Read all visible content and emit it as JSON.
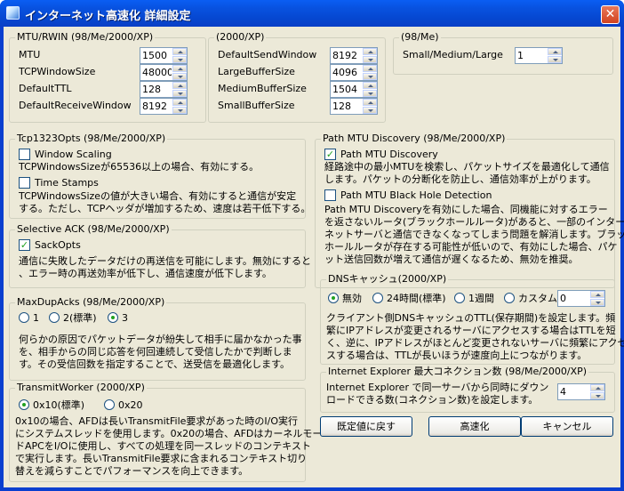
{
  "window": {
    "title": "インターネット高速化 詳細設定",
    "close_symbol": "✕"
  },
  "mtu_group": {
    "title": "MTU/RWIN (98/Me/2000/XP)",
    "fields": [
      {
        "label": "MTU",
        "value": "1500"
      },
      {
        "label": "TCPWindowSize",
        "value": "48000"
      },
      {
        "label": "DefaultTTL",
        "value": "128"
      },
      {
        "label": "DefaultReceiveWindow",
        "value": "8192"
      }
    ]
  },
  "buffer_group": {
    "title": "(2000/XP)",
    "fields": [
      {
        "label": "DefaultSendWindow",
        "value": "8192"
      },
      {
        "label": "LargeBufferSize",
        "value": "4096"
      },
      {
        "label": "MediumBufferSize",
        "value": "1504"
      },
      {
        "label": "SmallBufferSize",
        "value": "128"
      }
    ]
  },
  "size_group": {
    "title": "(98/Me)",
    "label": "Small/Medium/Large",
    "value": "1"
  },
  "tcp1323": {
    "title": "Tcp1323Opts (98/Me/2000/XP)",
    "window_scaling": {
      "label": "Window Scaling",
      "checked": false
    },
    "window_scaling_desc": "TCPWindowsSizeが65536以上の場合、有効にする。",
    "time_stamps": {
      "label": "Time Stamps",
      "checked": false
    },
    "time_stamps_desc_1": "TCPWindowsSizeの値が大きい場合、有効にすると通信が安定",
    "time_stamps_desc_2": "する。ただし、TCPヘッダが増加するため、速度は若干低下する。"
  },
  "sack": {
    "title": "Selective ACK (98/Me/2000/XP)",
    "option": {
      "label": "SackOpts",
      "checked": true
    },
    "desc_1": "通信に失敗したデータだけの再送信を可能にします。無効にすると",
    "desc_2": "、エラー時の再送効率が低下し、通信速度が低下します。"
  },
  "maxdupacks": {
    "title": "MaxDupAcks (98/Me/2000/XP)",
    "options": [
      "1",
      "2(標準)",
      "3"
    ],
    "selected": "3",
    "desc_1": "何らかの原因でパケットデータが紛失して相手に届かなかった事",
    "desc_2": "を、相手からの同じ応答を何回連続して受信したかで判断しま",
    "desc_3": "す。その受信回数を指定することで、送受信を最適化します。"
  },
  "transmit": {
    "title": "TransmitWorker (2000/XP)",
    "options": [
      "0x10(標準)",
      "0x20"
    ],
    "selected": "0x10(標準)",
    "desc_1": "0x10の場合、AFDは長いTransmitFile要求があった時のI/O実行",
    "desc_2": "にシステムスレッドを使用します。0x20の場合、AFDはカーネルモー",
    "desc_3": "ドAPCをI/Oに使用し、すべての処理を同一スレッドのコンテキスト",
    "desc_4": "で実行します。長いTransmitFile要求に含まれるコンテキスト切り",
    "desc_5": "替えを減らすことでパフォーマンスを向上できます。"
  },
  "pmtu": {
    "title": "Path MTU Discovery (98/Me/2000/XP)",
    "discovery": {
      "label": "Path MTU Discovery",
      "checked": true
    },
    "discovery_desc_1": "経路途中の最小MTUを検索し、パケットサイズを最適化して通信",
    "discovery_desc_2": "します。パケットの分断化を防止し、通信効率が上がります。",
    "blackhole": {
      "label": "Path MTU Black Hole Detection",
      "checked": false
    },
    "blackhole_desc_1": "Path MTU Discoveryを有効にした場合、同機能に対するエラー",
    "blackhole_desc_2": "を返さないルータ(ブラックホールルータ)があると、一部のインター",
    "blackhole_desc_3": "ネットサーバと通信できなくなってしまう問題を解消します。ブラック",
    "blackhole_desc_4": "ホールルータが存在する可能性が低いので、有効にした場合、パケ",
    "blackhole_desc_5": "ット送信回数が増えて通信が遅くなるため、無効を推奨。"
  },
  "dns": {
    "title": "DNSキャッシュ(2000/XP)",
    "options": [
      "無効",
      "24時間(標準)",
      "1週間",
      "カスタム"
    ],
    "selected": "無効",
    "custom_value": "0",
    "desc_1": "クライアント側DNSキャッシュのTTL(保存期間)を設定します。頻",
    "desc_2": "繁にIPアドレスが変更されるサーバにアクセスする場合はTTLを短",
    "desc_3": "く、逆に、IPアドレスがほとんど変更されないサーバに頻繁にアクセ",
    "desc_4": "スする場合は、TTLが長いほうが速度向上につながります。"
  },
  "ie": {
    "title": "Internet Explorer 最大コネクション数 (98/Me/2000/XP)",
    "desc_1": "Internet Explorer で同一サーバから同時にダウン",
    "desc_2": "ロードできる数(コネクション数)を設定します。",
    "value": "4"
  },
  "buttons": {
    "reset": "既定値に戻す",
    "speedup": "高速化",
    "cancel": "キャンセル"
  }
}
